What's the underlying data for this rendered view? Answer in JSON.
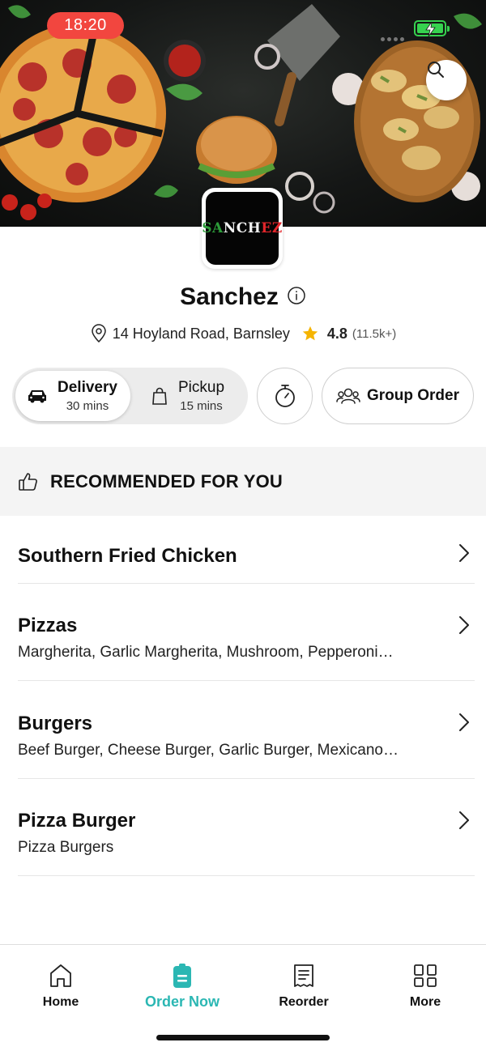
{
  "status_bar": {
    "time": "18:20"
  },
  "store": {
    "logo_text": "SANCHEZ",
    "name": "Sanchez",
    "address": "14 Hoyland Road, Barnsley",
    "rating": "4.8",
    "rating_count": "(11.5k+)"
  },
  "order_modes": {
    "delivery": {
      "label": "Delivery",
      "time": "30 mins",
      "selected": true
    },
    "pickup": {
      "label": "Pickup",
      "time": "15 mins",
      "selected": false
    }
  },
  "group_order_label": "Group Order",
  "recommended": {
    "title": "RECOMMENDED FOR YOU"
  },
  "categories": [
    {
      "name": "Southern Fried Chicken",
      "desc": ""
    },
    {
      "name": "Pizzas",
      "desc": "Margherita, Garlic Margherita, Mushroom, Pepperoni…"
    },
    {
      "name": "Burgers",
      "desc": "Beef Burger, Cheese Burger, Garlic Burger, Mexicano…"
    },
    {
      "name": "Pizza Burger",
      "desc": "Pizza Burgers"
    }
  ],
  "nav": {
    "home": "Home",
    "order_now": "Order Now",
    "reorder": "Reorder",
    "more": "More"
  },
  "colors": {
    "accent": "#2bb7b3",
    "status_pill": "#f2463f",
    "star": "#f5b400",
    "battery": "#36d24f"
  },
  "icons": [
    "search-icon",
    "info-icon",
    "location-pin-icon",
    "star-icon",
    "car-icon",
    "shopping-bag-icon",
    "timer-icon",
    "group-icon",
    "thumbs-up-icon",
    "chevron-right-icon",
    "home-icon",
    "order-now-icon",
    "reorder-receipt-icon",
    "more-grid-icon"
  ]
}
